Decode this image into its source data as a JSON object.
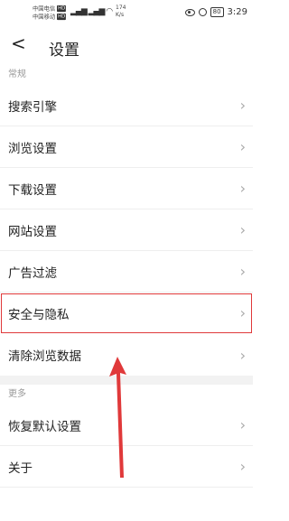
{
  "statusbar": {
    "carrier1": "中国电信",
    "carrier2": "中国移动",
    "hd": "HD",
    "speed_value": "174",
    "speed_unit": "K/s",
    "battery": "80",
    "time": "3:29"
  },
  "header": {
    "title": "设置"
  },
  "sections": {
    "general_label": "常规",
    "more_label": "更多"
  },
  "items": {
    "search_engine": "搜索引擎",
    "browse_settings": "浏览设置",
    "download_settings": "下载设置",
    "site_settings": "网站设置",
    "ad_filter": "广告过滤",
    "security_privacy": "安全与隐私",
    "clear_data": "清除浏览数据",
    "restore_defaults": "恢复默认设置",
    "about": "关于"
  },
  "annotation": {
    "highlight_color": "#e0393a"
  }
}
